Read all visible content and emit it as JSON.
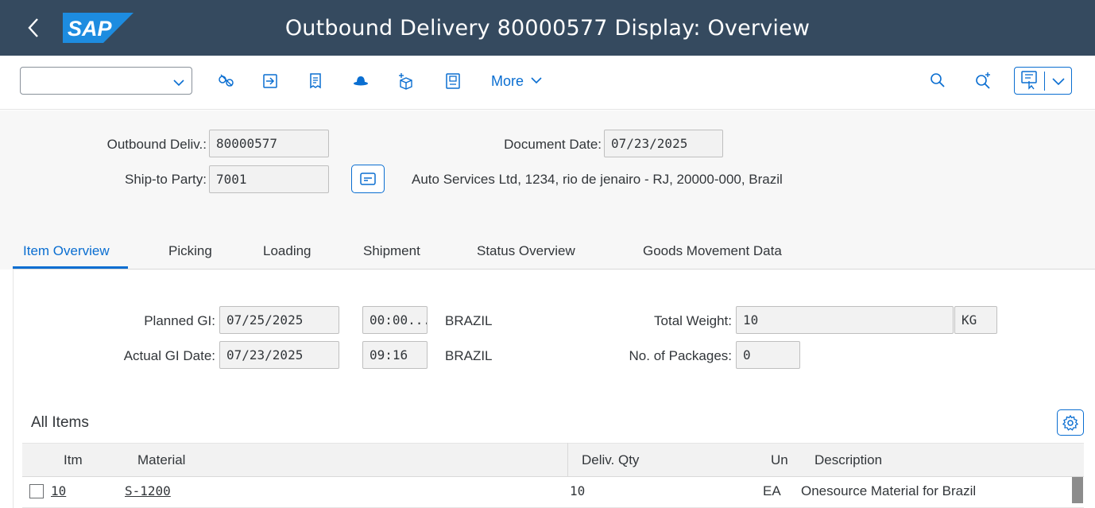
{
  "shell": {
    "title": "Outbound Delivery 80000577 Display: Overview",
    "logo_text": "SAP",
    "back_glyph": "<"
  },
  "toolbar": {
    "command_value": "",
    "more_label": "More",
    "icons": [
      "glasses-icon",
      "export-icon",
      "receipt-icon",
      "hat-icon",
      "package-add-icon",
      "document-icon",
      "search-icon",
      "zoom-in-icon",
      "screen-menu-icon"
    ]
  },
  "header": {
    "outbound_label": "Outbound Deliv.:",
    "outbound_value": "80000577",
    "docdate_label": "Document Date:",
    "docdate_value": "07/23/2025",
    "shipto_label": "Ship-to Party:",
    "shipto_value": "7001",
    "address_text": "Auto Services Ltd, 1234, rio de jenairo - RJ, 20000-000, Brazil"
  },
  "tabs": [
    {
      "label": "Item Overview",
      "active": true
    },
    {
      "label": "Picking"
    },
    {
      "label": "Loading"
    },
    {
      "label": "Shipment"
    },
    {
      "label": "Status Overview"
    },
    {
      "label": "Goods Movement Data"
    }
  ],
  "overview": {
    "planned_gi_label": "Planned GI:",
    "planned_gi_date": "07/25/2025",
    "planned_gi_time": "00:00...",
    "planned_gi_tz": "BRAZIL",
    "actual_gi_label": "Actual GI Date:",
    "actual_gi_date": "07/23/2025",
    "actual_gi_time": "09:16",
    "actual_gi_tz": "BRAZIL",
    "weight_label": "Total Weight:",
    "weight_value": "10",
    "weight_unit": "KG",
    "packages_label": "No. of Packages:",
    "packages_value": "0"
  },
  "items": {
    "title": "All Items",
    "columns": {
      "itm": "Itm",
      "material": "Material",
      "qty": "Deliv. Qty",
      "un": "Un",
      "description": "Description"
    },
    "rows": [
      {
        "itm": "10",
        "material": "S-1200",
        "qty": "10",
        "un": "EA",
        "description": "Onesource Material for Brazil"
      }
    ]
  },
  "colors": {
    "shell": "#354a5f",
    "accent": "#0a6ed1",
    "header_bg": "#f7f7f7"
  }
}
